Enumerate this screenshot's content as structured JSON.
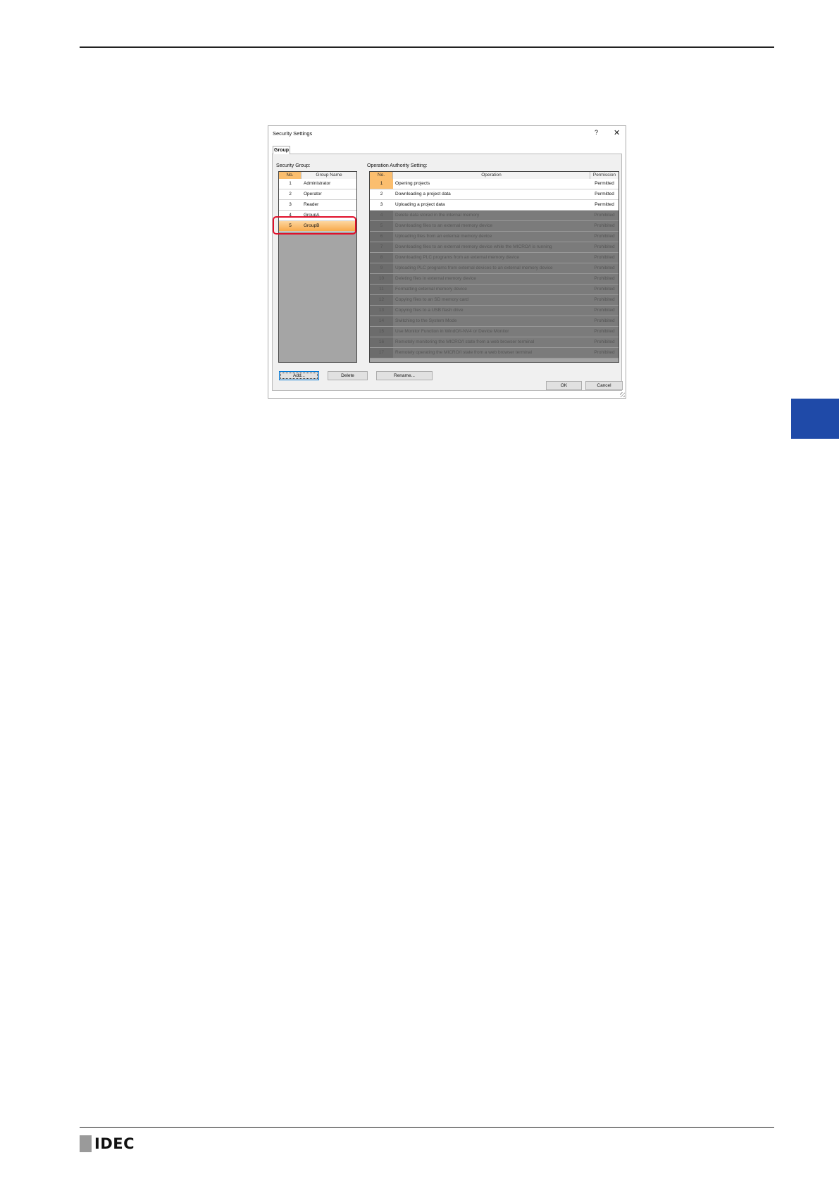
{
  "dialog": {
    "title": "Security Settings",
    "help_icon": "?",
    "close_icon": "✕",
    "tab_label": "Group",
    "security_group_label": "Security Group:",
    "operation_label": "Operation Authority Setting:"
  },
  "groups": {
    "headers": {
      "no": "No.",
      "name": "Group Name"
    },
    "rows": [
      {
        "no": "1",
        "name": "Administrator"
      },
      {
        "no": "2",
        "name": "Operator"
      },
      {
        "no": "3",
        "name": "Reader"
      },
      {
        "no": "4",
        "name": "GroupA"
      },
      {
        "no": "5",
        "name": "GroupB"
      }
    ]
  },
  "operations": {
    "headers": {
      "no": "No.",
      "operation": "Operation",
      "permission": "Permission"
    },
    "rows": [
      {
        "no": "1",
        "operation": "Opening projects",
        "permission": "Permitted"
      },
      {
        "no": "2",
        "operation": "Downloading a project data",
        "permission": "Permitted"
      },
      {
        "no": "3",
        "operation": "Uploading a project data",
        "permission": "Permitted"
      },
      {
        "no": "4",
        "operation": "Delete data stored in the internal memory",
        "permission": "Prohibited"
      },
      {
        "no": "5",
        "operation": "Downloading files to an external memory device",
        "permission": "Prohibited"
      },
      {
        "no": "6",
        "operation": "Uploading files from an external memory device",
        "permission": "Prohibited"
      },
      {
        "no": "7",
        "operation": "Downloading files to an external memory device while the MICRO/I is running",
        "permission": "Prohibited"
      },
      {
        "no": "8",
        "operation": "Downloading PLC programs from an external memory device",
        "permission": "Prohibited"
      },
      {
        "no": "9",
        "operation": "Uploading PLC programs from external devices to an external memory device",
        "permission": "Prohibited"
      },
      {
        "no": "10",
        "operation": "Deleting files in external memory device",
        "permission": "Prohibited"
      },
      {
        "no": "11",
        "operation": "Formatting external memory device",
        "permission": "Prohibited"
      },
      {
        "no": "12",
        "operation": "Copying files to an SD memory card",
        "permission": "Prohibited"
      },
      {
        "no": "13",
        "operation": "Copying files to a USB flash drive",
        "permission": "Prohibited"
      },
      {
        "no": "14",
        "operation": "Switching to the System Mode",
        "permission": "Prohibited"
      },
      {
        "no": "15",
        "operation": "Use Monitor Function in WindO/I-NV4 or Device Monitor",
        "permission": "Prohibited"
      },
      {
        "no": "16",
        "operation": "Remotely monitoring the MICRO/I state from a web browser terminal",
        "permission": "Prohibited"
      },
      {
        "no": "17",
        "operation": "Remotely operating the MICRO/I state from a web browser terminal",
        "permission": "Prohibited"
      }
    ]
  },
  "buttons": {
    "add": "Add...",
    "delete": "Delete",
    "rename": "Rename...",
    "ok": "OK",
    "cancel": "Cancel"
  },
  "footer": {
    "logo_text": "IDEC"
  },
  "colors": {
    "accent_blue": "#1f4aa8",
    "selection_orange": "#f8a94a",
    "highlight_red": "#e0102a"
  }
}
